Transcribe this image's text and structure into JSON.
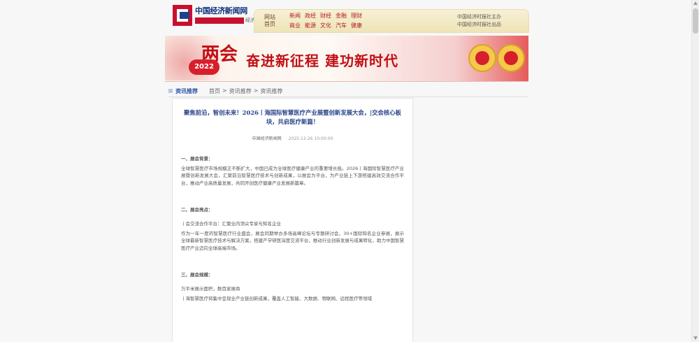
{
  "header": {
    "logo_text": "中国经济新闻网",
    "logo_sub": "经济"
  },
  "nav": {
    "home_label_top": "网站",
    "home_label_bottom": "首页",
    "row1": [
      "新闻",
      "政经",
      "财经",
      "金融",
      "理财"
    ],
    "row2": [
      "商业",
      "能源",
      "文化",
      "汽车",
      "健康"
    ],
    "right_top": "中国经济时报社主办",
    "right_bottom": "中国经济时报社出品"
  },
  "banner": {
    "brand": "两会",
    "year": "2022",
    "slogan": "奋进新征程 建功新时代"
  },
  "breadcrumb": {
    "title": "资讯推荐",
    "path": [
      "首页",
      "资讯推荐",
      "资讯推荐"
    ]
  },
  "article": {
    "title": "聚焦前沿，智创未来！2026丨海国际智慧医疗产业展暨创新发展大会，|交会核心板块，共启医疗新篇！",
    "source": "中国经济新闻网",
    "date": "2025-12-26 10:00:00",
    "sections": [
      {
        "heading": "一、展会背景：",
        "paragraphs": [
          "全球智慧医疗市场规模正不断扩大，中国已成为全球医疗健康产业的重要增长极。2026丨海国际智慧医疗产业展暨创新发展大会，汇聚前沿智慧医疗技术与创新成果，以展会为平台，为产业链上下游搭建高效交流合作平台，推动产业高质量发展，共同开创医疗健康产业发展新篇章。"
        ]
      },
      {
        "heading": "二、展会亮点：",
        "paragraphs": [
          "丨会交流合作平台：汇聚业内顶尖专家与知名企业",
          "作为一年一度的智慧医疗行业盛会，展会同期举办多场高峰论坛与专题研讨会，30+国际知名企业参展，展示全球最新智慧医疗技术与解决方案，搭建产学研医深度交流平台，推动行业创新发展与成果转化，助力中国智慧医疗产业迈向全球高端市场。"
        ]
      },
      {
        "heading": "三、展会规模：",
        "paragraphs": [
          "万平米展示面积，数百家展商",
          "丨海智慧医疗将集中呈现全产业链创新成果，覆盖人工智能、大数据、物联网、远程医疗等领域"
        ]
      }
    ]
  }
}
